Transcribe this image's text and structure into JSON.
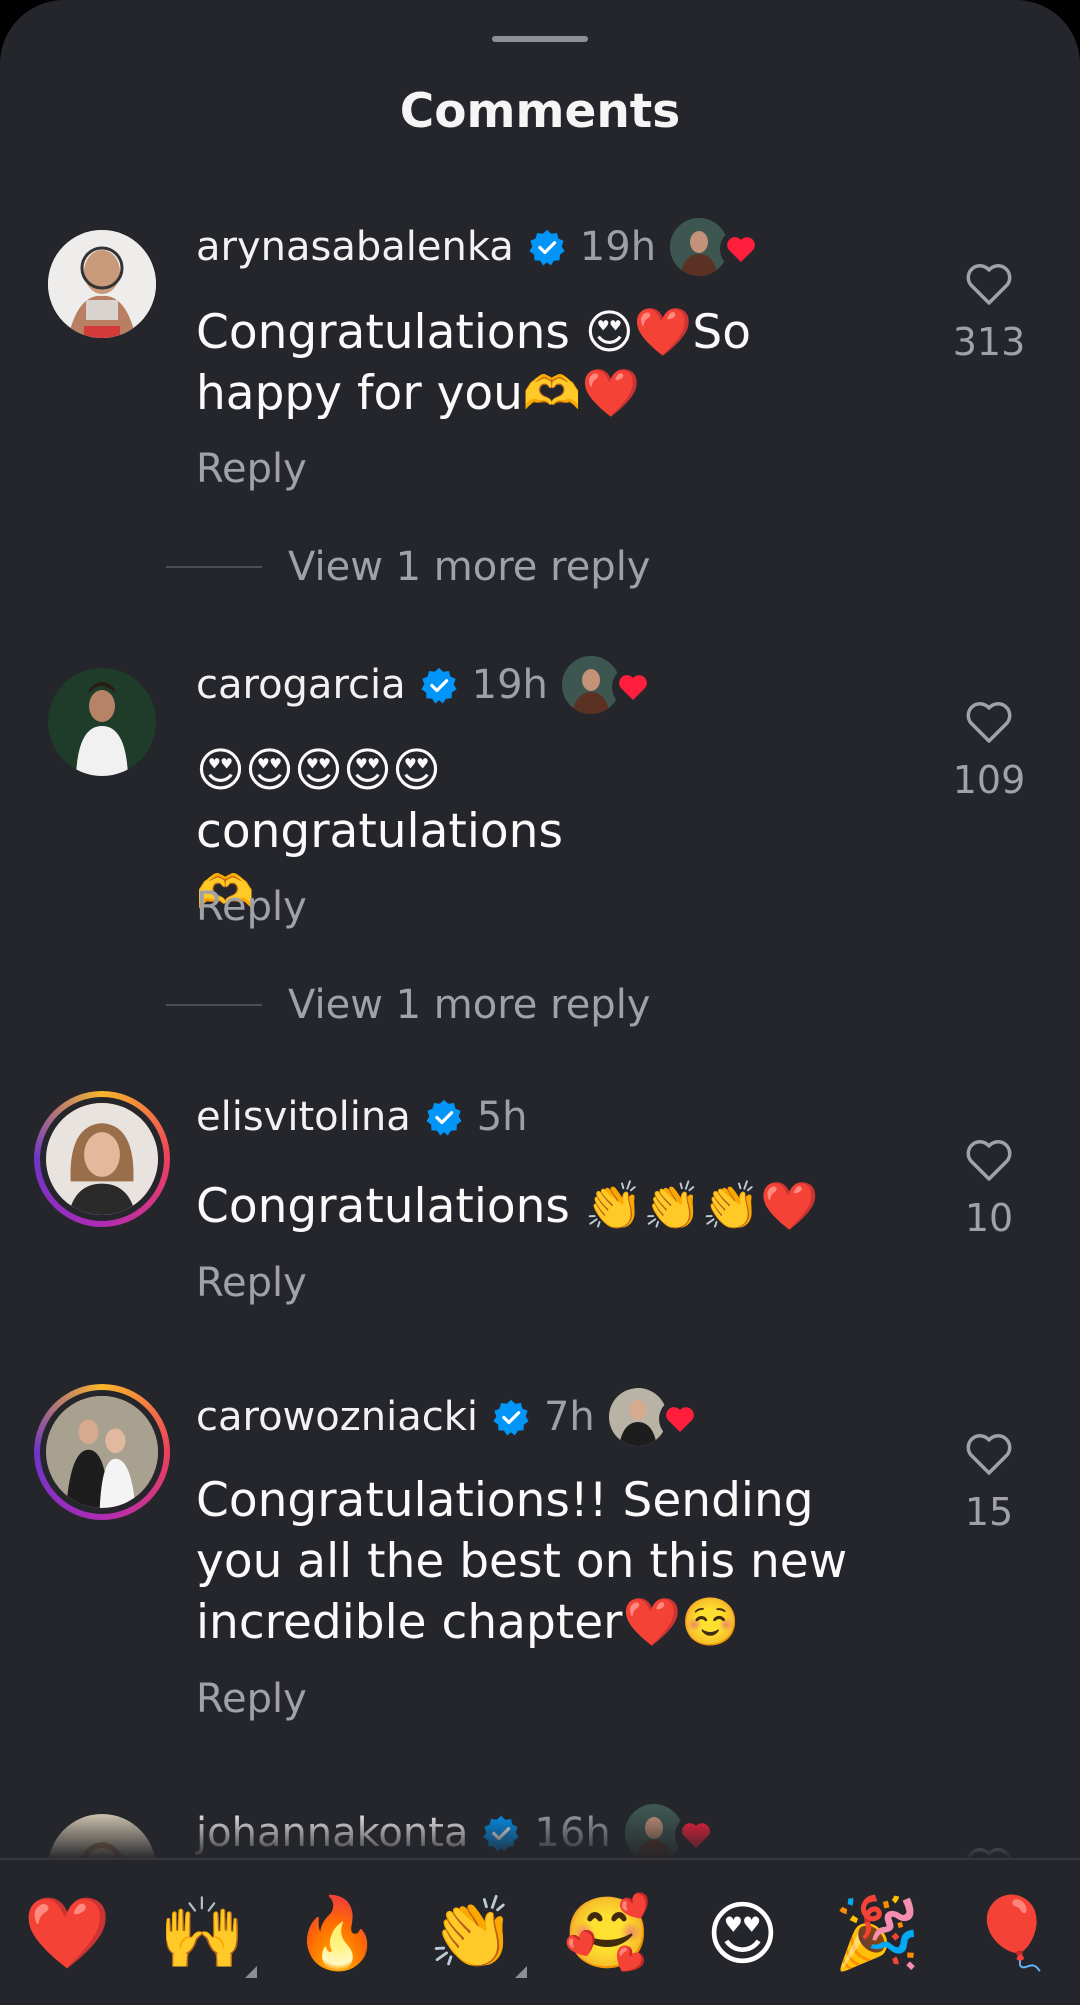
{
  "header": {
    "title": "Comments"
  },
  "comments": [
    {
      "username": "arynasabalenka",
      "time": "19h",
      "text": "Congratulations 😍❤️So happy for you🫶❤️",
      "reply_label": "Reply",
      "likes": "313",
      "more_replies": "View 1 more reply"
    },
    {
      "username": "carogarcia",
      "time": "19h",
      "text": "😍😍😍😍😍 congratulations 🫶",
      "reply_label": "Reply",
      "likes": "109",
      "more_replies": "View 1 more reply"
    },
    {
      "username": "elisvitolina",
      "time": "5h",
      "text": "Congratulations 👏👏👏❤️",
      "reply_label": "Reply",
      "likes": "10"
    },
    {
      "username": "carowozniacki",
      "time": "7h",
      "text": "Congratulations!! Sending you all the best on this new incredible chapter❤️☺️",
      "reply_label": "Reply",
      "likes": "15"
    },
    {
      "username": "johannakonta",
      "time": "16h"
    }
  ],
  "emoji_bar": [
    "❤️",
    "🙌",
    "🔥",
    "👏",
    "🥰",
    "😍",
    "🎉",
    "🎈"
  ],
  "colors": {
    "background": "#25262b",
    "verified": "#0095f6",
    "heart": "#ff1f3d",
    "muted_text": "#a0a2a8"
  }
}
